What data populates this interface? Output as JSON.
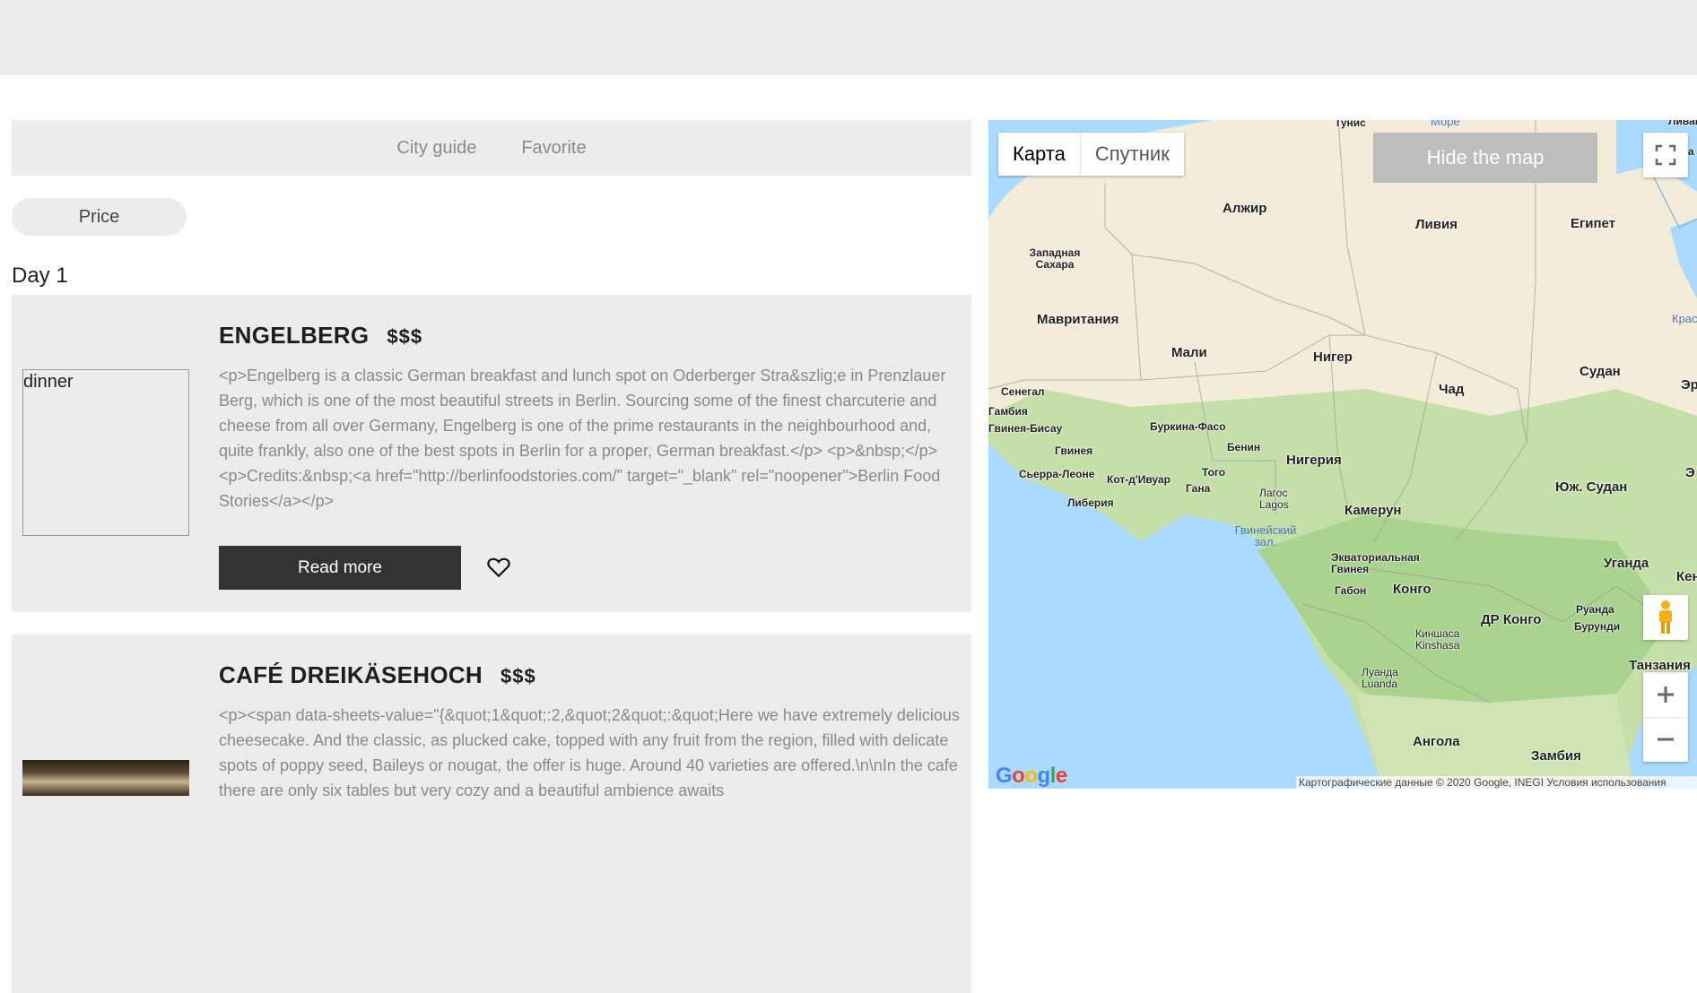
{
  "nav": {
    "items": [
      "City guide",
      "Favorite"
    ]
  },
  "filter": {
    "price_label": "Price"
  },
  "day": {
    "label": "Day 1"
  },
  "cards": [
    {
      "title": "ENGELBERG",
      "price": "$$$",
      "img_alt": "dinner",
      "description": "<p>Engelberg is a classic German breakfast and lunch spot on Oderberger Stra&szlig;e in Prenzlauer Berg, which is one of the most beautiful streets in Berlin. Sourcing some of the finest charcuterie and cheese from all over Germany, Engelberg is one of the prime restaurants in the neighbourhood and, quite frankly, also one of the best spots in Berlin for a proper, German breakfast.</p> <p>&nbsp;</p> <p>Credits:&nbsp;<a href=\"http://berlinfoodstories.com/\" target=\"_blank\" rel=\"noopener\">Berlin Food Stories</a></p>",
      "button": "Read more"
    },
    {
      "title": "CAFÉ DREIKÄSEHOCH",
      "price": "$$$",
      "description": "<p><span data-sheets-value=\"{&quot;1&quot;:2,&quot;2&quot;:&quot;Here we have extremely delicious cheesecake. And the classic, as plucked cake, topped with any fruit from the region, filled with delicate spots of poppy seed, Baileys or nougat, the offer is huge. Around 40 varieties are offered.\\n\\nIn the cafe there are only six tables but very cozy and a beautiful ambience awaits"
    }
  ],
  "map": {
    "type_map": "Карта",
    "type_satellite": "Спутник",
    "hide_button": "Hide the map",
    "google_logo": "Google",
    "attribution": "Картографические данные © 2020 Google, INEGI    Условия использования",
    "labels": {
      "tunisia": "Тунис",
      "sea": "Море",
      "lebanon": "Ливан",
      "israel": "Изра",
      "algeria": "Алжир",
      "libya": "Ливия",
      "egypt": "Египет",
      "western_sahara": "Западная Сахара",
      "mauritania": "Мавритания",
      "mali": "Мали",
      "niger": "Нигер",
      "chad": "Чад",
      "sudan": "Судан",
      "eritrea": "Эр",
      "red_sea": "Крас",
      "senegal": "Сенегал",
      "gambia": "Гамбия",
      "guinea_bissau": "Гвинея-Бисау",
      "guinea": "Гвинея",
      "burkina": "Буркина-Фасо",
      "benin": "Бенин",
      "nigeria": "Нигерия",
      "sierra_leone": "Сьерра-Леоне",
      "cote": "Кот-д'Ивуар",
      "togo": "Того",
      "ghana": "Гана",
      "liberia": "Либерия",
      "lagos": "Лагос Lagos",
      "cameroon": "Камерун",
      "south_sudan": "Юж. Судан",
      "ethiopia": "Э",
      "gulf": "Гвинейский зал.",
      "eq_guinea": "Экваториальная Гвинея",
      "gabon": "Габон",
      "congo": "Конго",
      "uganda": "Уганда",
      "kenya": "Кен",
      "drc": "ДР Конго",
      "rwanda": "Руанда",
      "burundi": "Бурунди",
      "kinshasa": "Киншаса Kinshasa",
      "tanzania": "Танзания",
      "luanda": "Луанда Luanda",
      "angola": "Ангола",
      "zambia": "Замбия"
    }
  }
}
